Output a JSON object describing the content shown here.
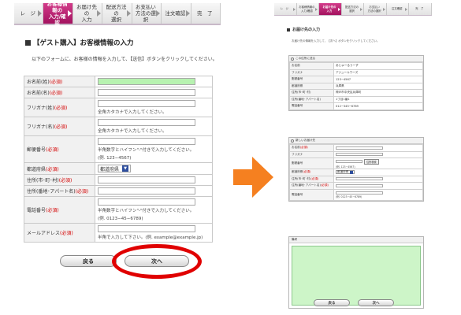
{
  "left": {
    "steps": [
      {
        "label": "レ　ジ",
        "active": false
      },
      {
        "label": "お客様情報の\n入力/確認",
        "active": true
      },
      {
        "label": "お届け先の\n入力",
        "active": false
      },
      {
        "label": "配送方法の\n選択",
        "active": false
      },
      {
        "label": "お支払い\n方法の選択",
        "active": false
      },
      {
        "label": "注文確認",
        "active": false
      },
      {
        "label": "完　了",
        "active": false
      }
    ],
    "title": "【ゲスト購入】お客様情報の入力",
    "intro": "以下のフォームに、お客様の情報を入力して、【送信】ボタンをクリックしてください。",
    "required": "(必須)",
    "fields": {
      "lastname": "お名前(姓)",
      "firstname": "お名前(名)",
      "kana_last": "フリガナ(姓)",
      "kana_last_hint": "全角カタカナで入力してください。",
      "kana_first": "フリガナ(名)",
      "kana_first_hint": "全角カタカナで入力してください。",
      "zip": "郵便番号",
      "zip_hint": "半角数字とハイフン\"-\"付きで入力してください。",
      "zip_example": "(例. 123−4567)",
      "pref": "都道府県",
      "pref_value": "都道府県",
      "city": "住所(市･町･村)",
      "street": "住所(番地･アパート名)",
      "phone": "電話番号",
      "phone_hint": "半角数字とハイフン\"-\"付きで入力してください。",
      "phone_example": "(例. 0123−45−6789)",
      "email": "メールアドレス",
      "email_hint": "半角で入力して下さい。(例. example@example.jp)"
    },
    "back_button": "戻る",
    "next_button": "次へ"
  },
  "right": {
    "steps": [
      {
        "label": "レ　ジ",
        "active": false
      },
      {
        "label": "お客様情報の\n入力/確認",
        "active": false
      },
      {
        "label": "お届け先の\n入力",
        "active": true
      },
      {
        "label": "配送方法の\n選択",
        "active": false
      },
      {
        "label": "お支払い\n方法の選択",
        "active": false
      },
      {
        "label": "注文確認",
        "active": false
      },
      {
        "label": "完　了",
        "active": false
      }
    ],
    "title": "お届け先の入力",
    "intro": "お届け先の情報を入力して、【次へ】ボタンをクリックしてください。",
    "option_same": "この住所に送る",
    "same": [
      {
        "label": "お名前",
        "value": "あじゅーるうーず"
      },
      {
        "label": "フリガナ",
        "value": "アジュールウーズ"
      },
      {
        "label": "郵便番号",
        "value": "123−4567"
      },
      {
        "label": "都道府県",
        "value": "兵庫県"
      },
      {
        "label": "住所(市･町･村)",
        "value": "神戸市中央区兵庫町"
      },
      {
        "label": "住所(番地･アパート名)",
        "value": "1丁目1番1"
      },
      {
        "label": "電話番号",
        "value": "012−345−6789"
      }
    ],
    "option_new": "新しいお届け先",
    "new_fields": {
      "name": "お名前",
      "kana": "フリガナ",
      "zip": "郵便番号",
      "zip_search": "住所検索",
      "zip_example": "(例. 123−4567)",
      "pref": "都道府県",
      "pref_value": "都道府県",
      "city": "住所(市･町･村)",
      "street": "住所(番地･アパート名)",
      "phone": "電話番号",
      "phone_example": "(例. 0123−45−6789)"
    },
    "required": "(必須)",
    "remarks": "備考",
    "back_button": "戻る",
    "next_button": "次へ"
  },
  "colors": {
    "accent": "#b71c6c",
    "arrow": "#f58020",
    "highlight_ring": "#e00000",
    "required": "#d40000"
  }
}
